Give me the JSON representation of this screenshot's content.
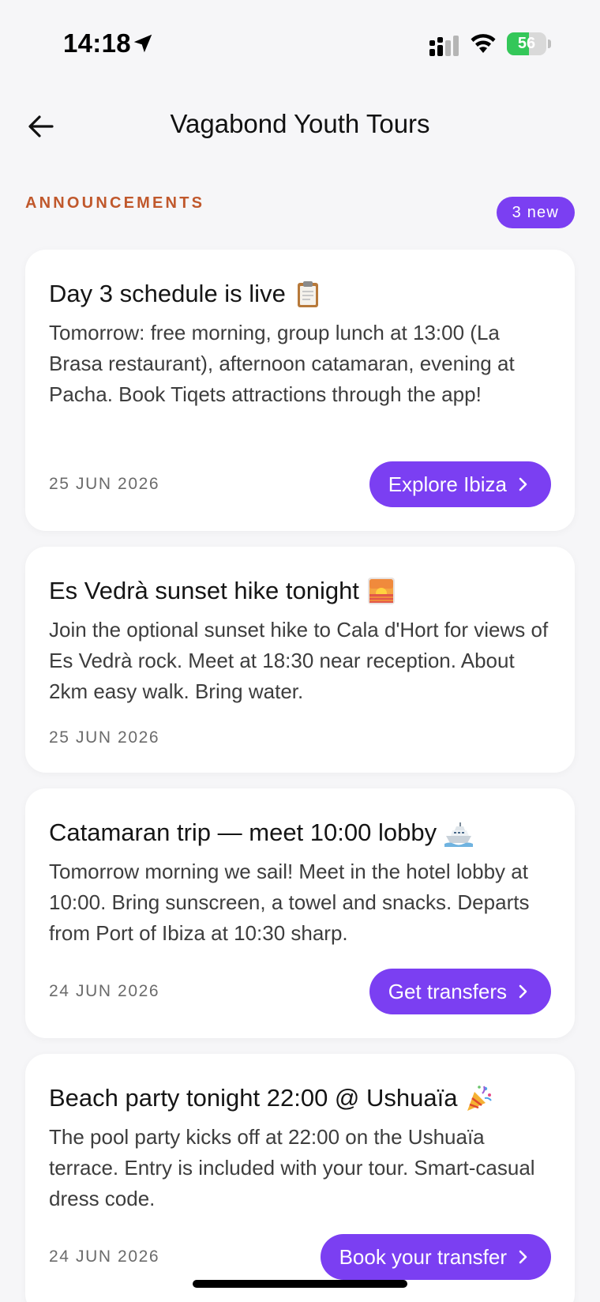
{
  "status_bar": {
    "time": "14:18",
    "battery": "56",
    "battery_level": 0.56,
    "icons": [
      "location-arrow-icon",
      "signal-icon",
      "wifi-icon",
      "battery-charging-icon"
    ]
  },
  "header": {
    "title": "Vagabond Youth Tours",
    "back_icon": "arrow-left-icon"
  },
  "section": {
    "label": "ANNOUNCEMENTS",
    "badge": "3 new"
  },
  "colors": {
    "accent": "#7b3ff2",
    "section_label": "#c0582c",
    "background": "#f6f6f8",
    "battery_green": "#34c759"
  },
  "announcements": [
    {
      "title": "Day 3 schedule is live",
      "emoji": "clipboard-icon",
      "body": "Tomorrow: free morning, group lunch at 13:00 (La Brasa restaurant), afternoon catamaran, evening at Pacha. Book Tiqets attractions through the app!",
      "date": "25 JUN 2026",
      "button": "Explore Ibiza"
    },
    {
      "title": "Es Vedrà sunset hike tonight",
      "emoji": "sunset-icon",
      "body": "Join the optional sunset hike to Cala d'Hort for views of Es Vedrà rock. Meet at 18:30 near reception. About 2km easy walk. Bring water.",
      "date": "25 JUN 2026",
      "button": ""
    },
    {
      "title": "Catamaran trip — meet 10:00 lobby",
      "emoji": "ship-icon",
      "body": "Tomorrow morning we sail! Meet in the hotel lobby at 10:00. Bring sunscreen, a towel and snacks. Departs from Port of Ibiza at 10:30 sharp.",
      "date": "24 JUN 2026",
      "button": "Get transfers"
    },
    {
      "title": "Beach party tonight 22:00 @ Ushuaïa",
      "emoji": "party-popper-icon",
      "body": "The pool party kicks off at 22:00 on the Ushuaïa terrace. Entry is included with your tour. Smart-casual dress code.",
      "date": "24 JUN 2026",
      "button": "Book your transfer"
    }
  ]
}
